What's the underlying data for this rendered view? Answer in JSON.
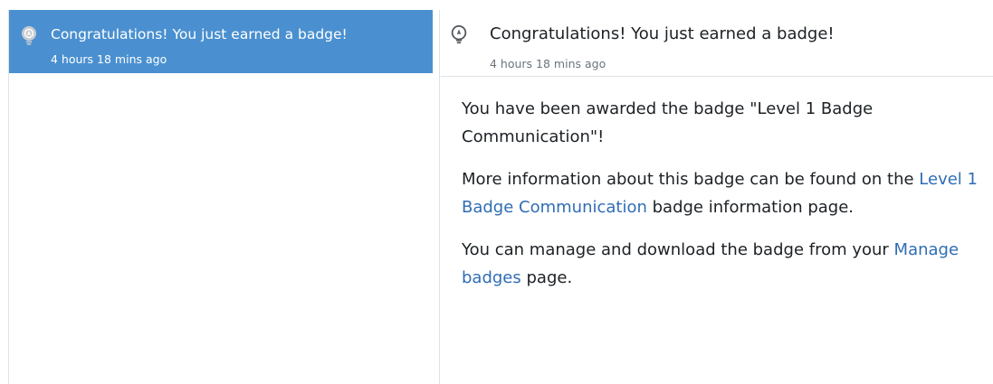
{
  "notifications": {
    "list": [
      {
        "title": "Congratulations! You just earned a badge!",
        "time": "4 hours 18 mins ago",
        "icon": "lightbulb-icon"
      }
    ]
  },
  "detail": {
    "icon": "lightbulb-icon",
    "title": "Congratulations! You just earned a badge!",
    "time": "4 hours 18 mins ago",
    "paragraph1": "You have been awarded the badge \"Level 1 Badge Communication\"!",
    "paragraph2_before": "More information about this badge can be found on the ",
    "paragraph2_link": "Level 1 Badge Communication",
    "paragraph2_after": " badge information page.",
    "paragraph3_before": "You can manage and download the badge from your ",
    "paragraph3_link": "Manage badges",
    "paragraph3_after": " page."
  },
  "colors": {
    "selected_bg": "#4a90d0",
    "link": "#2f6db5",
    "text": "#1d2125",
    "muted": "#6a737b"
  }
}
